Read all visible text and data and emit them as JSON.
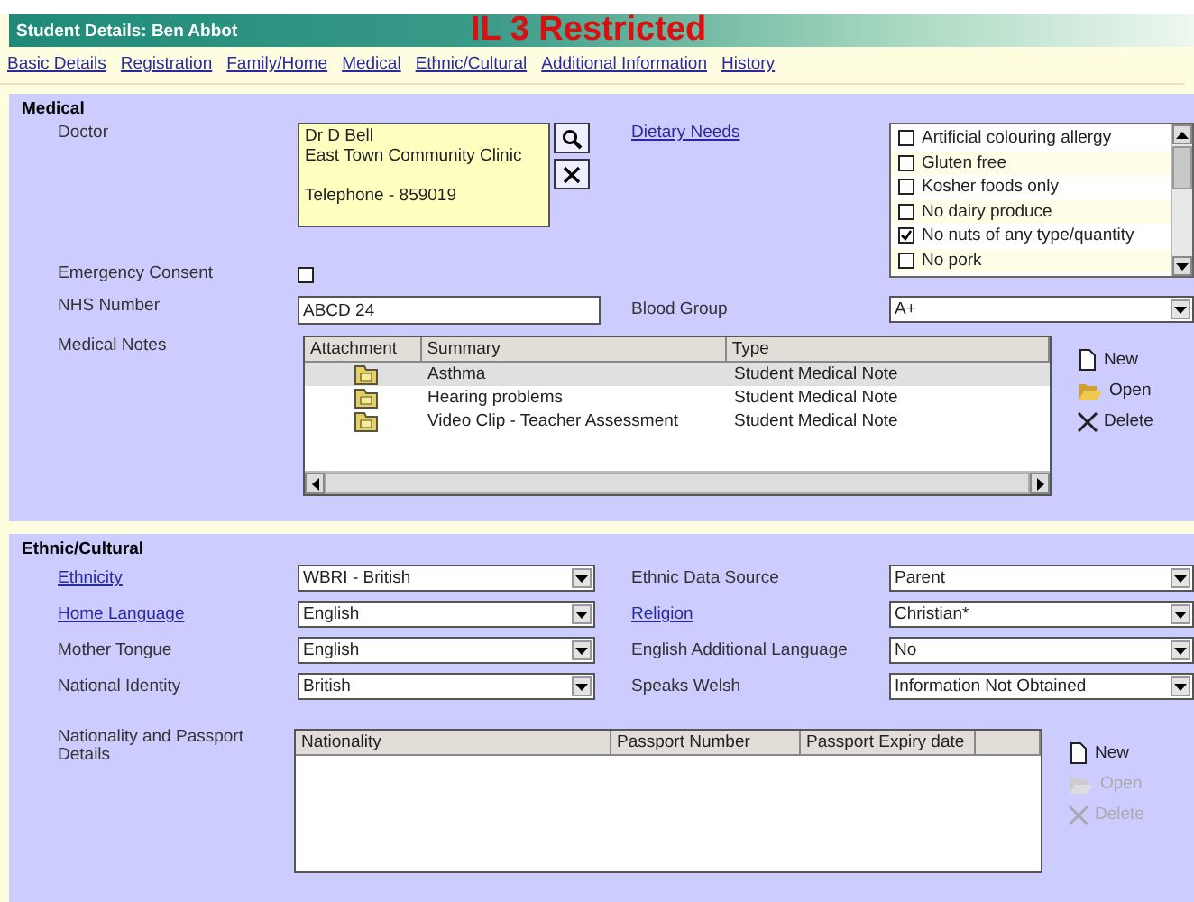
{
  "title_bar": {
    "title": "Student Details: Ben Abbot",
    "banner": "IL 3 Restricted"
  },
  "tabs": [
    {
      "label": "Basic Details"
    },
    {
      "label": "Registration"
    },
    {
      "label": "Family/Home"
    },
    {
      "label": "Medical"
    },
    {
      "label": "Ethnic/Cultural"
    },
    {
      "label": "Additional Information"
    },
    {
      "label": "History"
    }
  ],
  "medical": {
    "heading": "Medical",
    "doctor": {
      "label": "Doctor",
      "lines": [
        "Dr D Bell",
        "East Town Community Clinic"
      ],
      "phone": "Telephone - 859019"
    },
    "dietary": {
      "label": "Dietary Needs",
      "link": true,
      "options": [
        {
          "label": "Artificial colouring allergy",
          "checked": false
        },
        {
          "label": "Gluten free",
          "checked": false
        },
        {
          "label": "Kosher foods only",
          "checked": false
        },
        {
          "label": "No dairy produce",
          "checked": false
        },
        {
          "label": "No nuts of any type/quantity",
          "checked": true
        },
        {
          "label": "No pork",
          "checked": false
        }
      ]
    },
    "emergency_consent": {
      "label": "Emergency Consent",
      "checked": false
    },
    "nhs_number": {
      "label": "NHS Number",
      "value": "ABCD 24"
    },
    "blood_group": {
      "label": "Blood Group",
      "value": "A+"
    },
    "notes": {
      "label": "Medical Notes",
      "columns": [
        "Attachment",
        "Summary",
        "Type"
      ],
      "rows": [
        {
          "summary": "Asthma",
          "type": "Student Medical Note",
          "selected": true
        },
        {
          "summary": "Hearing problems",
          "type": "Student Medical Note",
          "selected": false
        },
        {
          "summary": "Video Clip - Teacher Assessment",
          "type": "Student Medical Note",
          "selected": false
        }
      ],
      "actions": [
        {
          "kind": "new",
          "label": "New",
          "disabled": false
        },
        {
          "kind": "open",
          "label": "Open",
          "disabled": false
        },
        {
          "kind": "delete",
          "label": "Delete",
          "disabled": false
        }
      ]
    }
  },
  "ethnic": {
    "heading": "Ethnic/Cultural",
    "fields": [
      {
        "label": "Ethnicity",
        "link": true,
        "value": "WBRI - British"
      },
      {
        "label": "Ethnic Data Source",
        "link": false,
        "value": "Parent"
      },
      {
        "label": "Home Language",
        "link": true,
        "value": "English"
      },
      {
        "label": "Religion",
        "link": true,
        "value": "Christian*"
      },
      {
        "label": "Mother Tongue",
        "link": false,
        "value": "English"
      },
      {
        "label": "English Additional Language",
        "link": false,
        "value": "No"
      },
      {
        "label": "National Identity",
        "link": false,
        "value": "British"
      },
      {
        "label": "Speaks Welsh",
        "link": false,
        "value": "Information Not Obtained"
      }
    ],
    "passports": {
      "label": "Nationality and Passport Details",
      "columns": [
        "Nationality",
        "Passport Number",
        "Passport Expiry date"
      ],
      "actions": [
        {
          "kind": "new",
          "label": "New",
          "disabled": false
        },
        {
          "kind": "open",
          "label": "Open",
          "disabled": true
        },
        {
          "kind": "delete",
          "label": "Delete",
          "disabled": true
        }
      ]
    }
  }
}
